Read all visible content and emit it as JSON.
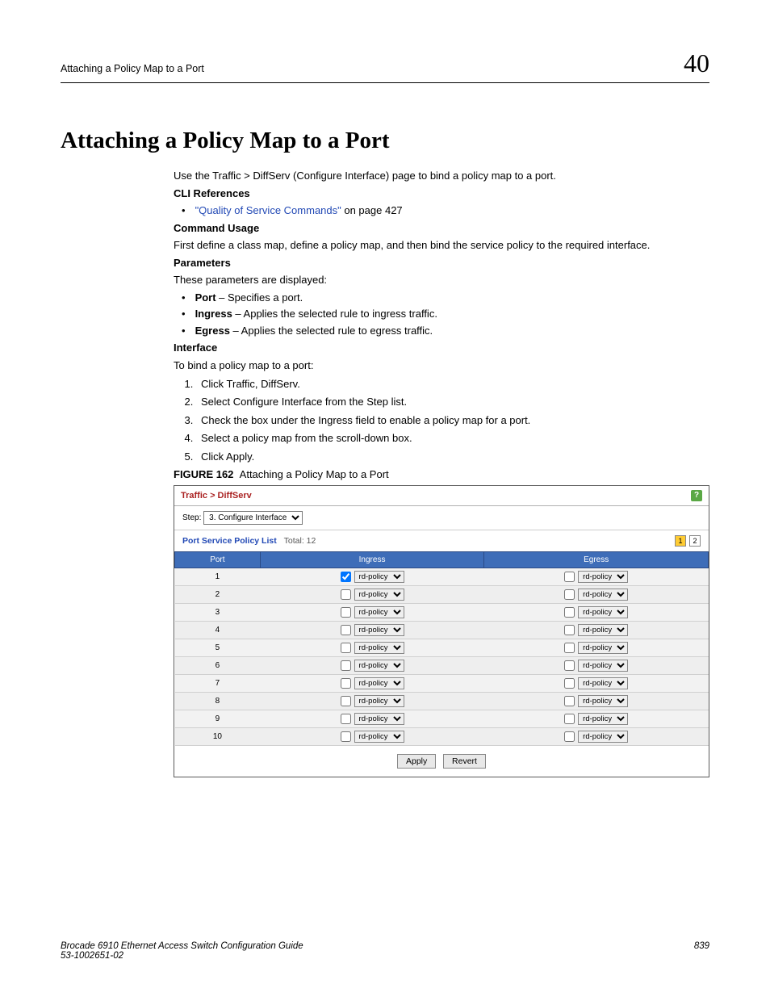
{
  "header": {
    "left": "Attaching a Policy Map to a Port",
    "chapter": "40"
  },
  "title": "Attaching a Policy Map to a Port",
  "intro": "Use the Traffic > DiffServ (Configure Interface) page to bind a policy map to a port.",
  "cli_ref": {
    "heading": "CLI References",
    "link_text": "\"Quality of Service Commands\"",
    "suffix": " on page 427"
  },
  "usage": {
    "heading": "Command Usage",
    "text": "First define a class map, define a policy map, and then bind the service policy to the required interface."
  },
  "params": {
    "heading": "Parameters",
    "intro": "These parameters are displayed:",
    "items": [
      {
        "name": "Port",
        "desc": " – Specifies a port."
      },
      {
        "name": "Ingress",
        "desc": " – Applies the selected rule to ingress traffic."
      },
      {
        "name": "Egress",
        "desc": " – Applies the selected rule to egress traffic."
      }
    ]
  },
  "interface": {
    "heading": "Interface",
    "intro": "To bind a policy map to a port:",
    "steps": [
      "Click Traffic, DiffServ.",
      "Select Configure Interface from the Step list.",
      "Check the box under the Ingress field to enable a policy map for a port.",
      "Select a policy map from the scroll-down box.",
      "Click Apply."
    ]
  },
  "figure": {
    "label": "FIGURE 162",
    "caption": "Attaching a Policy Map to a Port",
    "breadcrumb": "Traffic > DiffServ",
    "help": "?",
    "step_label": "Step:",
    "step_value": "3. Configure Interface",
    "list_title": "Port Service Policy List",
    "total_label": "Total: 12",
    "pager": [
      "1",
      "2"
    ],
    "cols": [
      "Port",
      "Ingress",
      "Egress"
    ],
    "policy_option": "rd-policy",
    "rows": [
      {
        "port": "1",
        "ingress_checked": true
      },
      {
        "port": "2",
        "ingress_checked": false
      },
      {
        "port": "3",
        "ingress_checked": false
      },
      {
        "port": "4",
        "ingress_checked": false
      },
      {
        "port": "5",
        "ingress_checked": false
      },
      {
        "port": "6",
        "ingress_checked": false
      },
      {
        "port": "7",
        "ingress_checked": false
      },
      {
        "port": "8",
        "ingress_checked": false
      },
      {
        "port": "9",
        "ingress_checked": false
      },
      {
        "port": "10",
        "ingress_checked": false
      }
    ],
    "apply": "Apply",
    "revert": "Revert"
  },
  "footer": {
    "line1": "Brocade 6910 Ethernet Access Switch Configuration Guide",
    "line2": "53-1002651-02",
    "page": "839"
  }
}
